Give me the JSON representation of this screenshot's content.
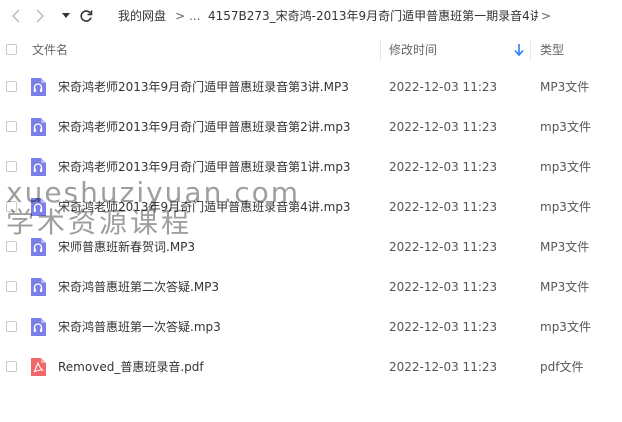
{
  "breadcrumb": {
    "root": "我的网盘",
    "separator": ">",
    "ellipsis": "...",
    "current": "4157B273_宋奇鸿-2013年9月奇门遁甲普惠班第一期录音4讲"
  },
  "header": {
    "name": "文件名",
    "time": "修改时间",
    "type": "类型"
  },
  "files": [
    {
      "name": "宋奇鸿老师2013年9月奇门遁甲普惠班录音第3讲.MP3",
      "time": "2022-12-03 11:23",
      "type": "MP3文件",
      "icon": "audio-file-icon"
    },
    {
      "name": "宋奇鸿老师2013年9月奇门遁甲普惠班录音第2讲.mp3",
      "time": "2022-12-03 11:23",
      "type": "mp3文件",
      "icon": "audio-file-icon"
    },
    {
      "name": "宋奇鸿老师2013年9月奇门遁甲普惠班录音第1讲.mp3",
      "time": "2022-12-03 11:23",
      "type": "mp3文件",
      "icon": "audio-file-icon"
    },
    {
      "name": "宋奇鸿老师2013年9月奇门遁甲普惠班录音第4讲.mp3",
      "time": "2022-12-03 11:23",
      "type": "mp3文件",
      "icon": "audio-file-icon"
    },
    {
      "name": "宋师普惠班新春贺词.MP3",
      "time": "2022-12-03 11:23",
      "type": "MP3文件",
      "icon": "audio-file-icon"
    },
    {
      "name": "宋奇鸿普惠班第二次答疑.MP3",
      "time": "2022-12-03 11:23",
      "type": "MP3文件",
      "icon": "audio-file-icon"
    },
    {
      "name": "宋奇鸿普惠班第一次答疑.mp3",
      "time": "2022-12-03 11:23",
      "type": "mp3文件",
      "icon": "audio-file-icon"
    },
    {
      "name": "Removed_普惠班录音.pdf",
      "time": "2022-12-03 11:23",
      "type": "pdf文件",
      "icon": "pdf-file-icon"
    }
  ],
  "watermark": {
    "line1": "xueshuziyuan.com",
    "line2": "学术资源课程"
  },
  "colors": {
    "audio_icon": "#7b7fe8",
    "pdf_icon": "#f0686b",
    "sort_icon": "#2a7fff"
  }
}
